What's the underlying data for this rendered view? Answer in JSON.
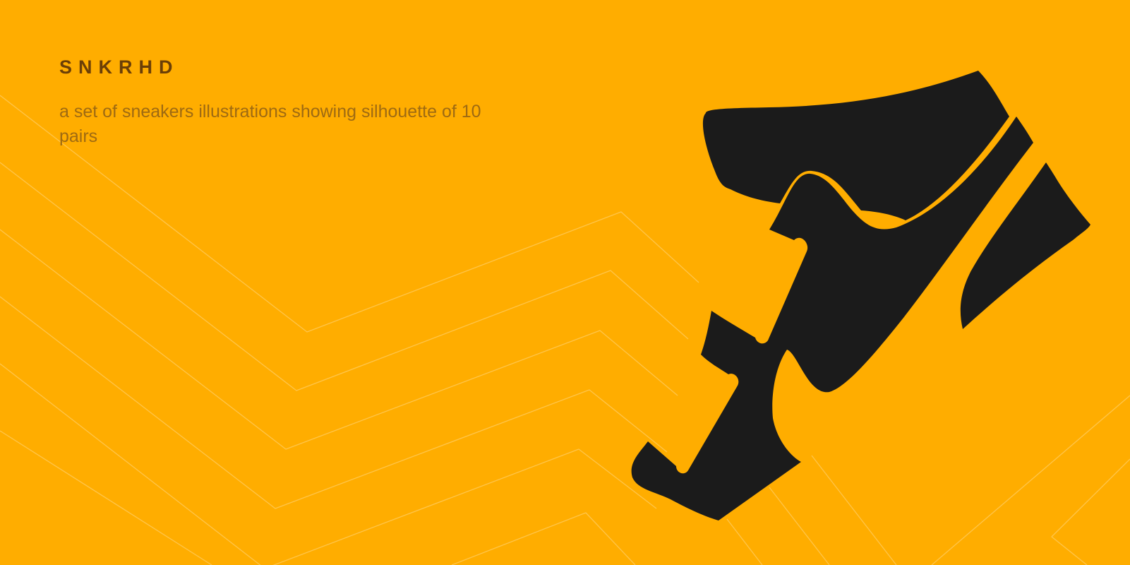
{
  "header": {
    "brand": "SNKRHD",
    "tagline": "a set of sneakers illustrations showing silhouette of 10 pairs"
  },
  "illustration": {
    "icon": "sneaker-silhouette-icon",
    "background_color": "#FFAD00",
    "silhouette_color": "#1b1b1b",
    "line_color": "#FFC54A"
  }
}
